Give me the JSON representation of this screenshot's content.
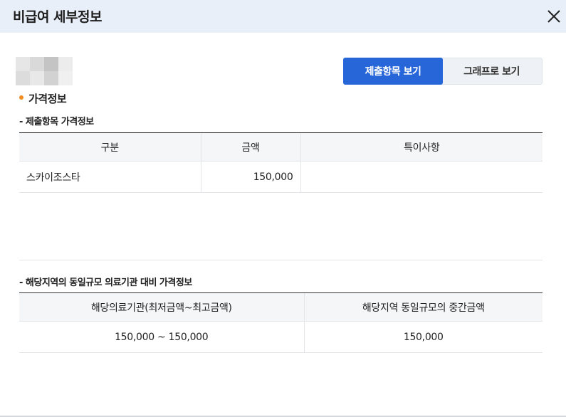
{
  "header": {
    "title": "비급여 세부정보"
  },
  "toggle": {
    "submitted_label": "제출항목 보기",
    "graph_label": "그래프로 보기"
  },
  "section": {
    "title": "가격정보"
  },
  "submitted": {
    "subtitle": "- 제출항목 가격정보",
    "columns": [
      "구분",
      "금액",
      "특이사항"
    ],
    "rows": [
      {
        "category": "스카이조스타",
        "amount": "150,000",
        "note": ""
      }
    ]
  },
  "regional": {
    "subtitle": "- 해당지역의 동일규모 의료기관 대비 가격정보",
    "columns": [
      "해당의료기관(최저금액~최고금액)",
      "해당지역 동일규모의 중간금액"
    ],
    "rows": [
      {
        "range": "150,000 ~ 150,000",
        "median": "150,000"
      }
    ]
  },
  "colors": {
    "accent": "#2666d8",
    "bullet": "#f28a1e",
    "header_bg": "#e9eff8"
  },
  "icons": {
    "close": "close-icon",
    "thumbnail": "blurred-thumbnail"
  }
}
